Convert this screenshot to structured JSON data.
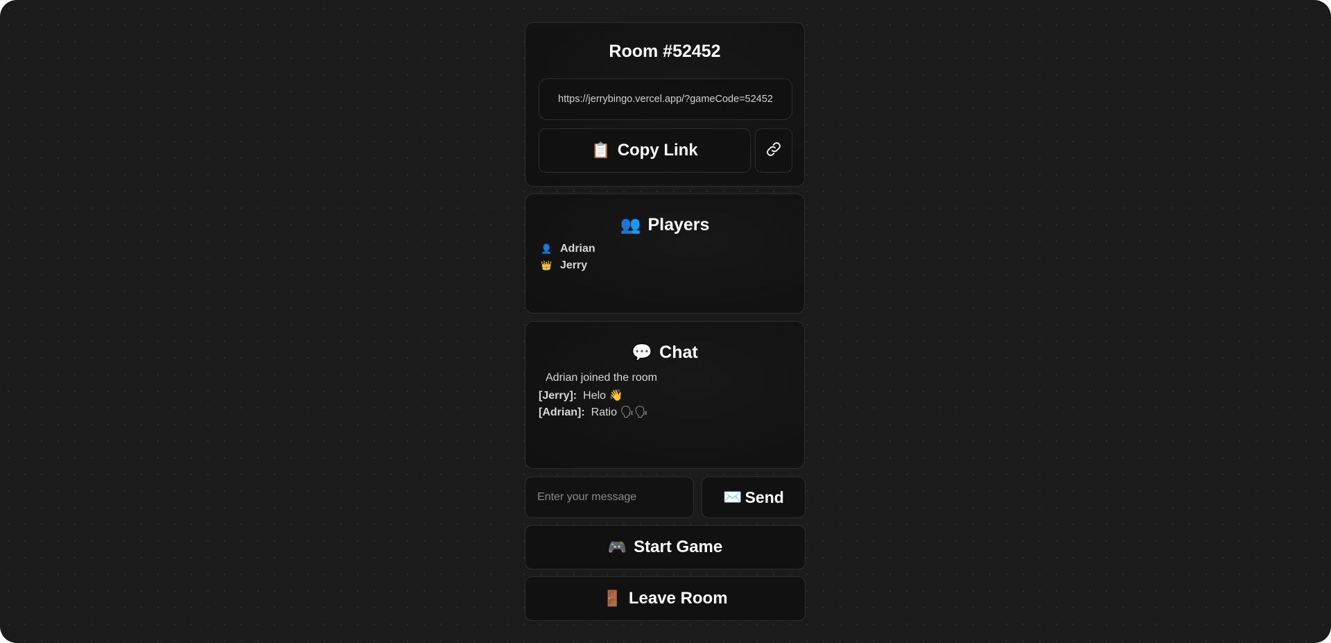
{
  "room": {
    "title": "Room #52452",
    "link": "https://jerrybingo.vercel.app/?gameCode=52452",
    "copy_emoji": "📋",
    "copy_label": "Copy Link",
    "link_icon": "link-icon"
  },
  "players": {
    "title_emoji": "👥",
    "title": "Players",
    "list": [
      {
        "icon": "👤",
        "name": "Adrian"
      },
      {
        "icon": "👑",
        "name": "Jerry"
      }
    ]
  },
  "chat": {
    "title_emoji": "💬",
    "title": "Chat",
    "system_message": "Adrian joined the room",
    "messages": [
      {
        "author": "[Jerry]:",
        "text": "Helo 👋"
      },
      {
        "author": "[Adrian]:",
        "text": "Ratio 🗣🗣"
      }
    ]
  },
  "composer": {
    "placeholder": "Enter your message",
    "value": "",
    "send_emoji": "✉️",
    "send_label": "Send"
  },
  "actions": {
    "start_emoji": "🎮",
    "start_label": "Start Game",
    "leave_emoji": "🚪",
    "leave_label": "Leave Room"
  }
}
